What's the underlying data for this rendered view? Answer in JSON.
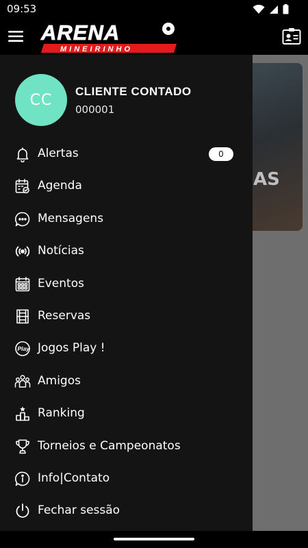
{
  "status_bar": {
    "time": "09:53"
  },
  "header": {
    "logo_main": "ARENA",
    "logo_sub": "MINEIRINHO"
  },
  "banner": {
    "text": "AS"
  },
  "user": {
    "initials": "CC",
    "name": "CLIENTE CONTADO",
    "id": "000001"
  },
  "menu": {
    "items": [
      {
        "label": "Alertas",
        "icon": "bell-icon",
        "badge": "0"
      },
      {
        "label": "Agenda",
        "icon": "calendar-check-icon"
      },
      {
        "label": "Mensagens",
        "icon": "chat-bubble-icon"
      },
      {
        "label": "Notícias",
        "icon": "broadcast-icon"
      },
      {
        "label": "Eventos",
        "icon": "calendar-grid-icon"
      },
      {
        "label": "Reservas",
        "icon": "court-icon"
      },
      {
        "label": "Jogos Play !",
        "icon": "play-badge-icon"
      },
      {
        "label": "Amigos",
        "icon": "people-icon"
      },
      {
        "label": "Ranking",
        "icon": "podium-icon"
      },
      {
        "label": "Torneios e Campeonatos",
        "icon": "trophy-icon"
      },
      {
        "label": "Info|Contato",
        "icon": "info-icon"
      },
      {
        "label": "Fechar sessão",
        "icon": "power-icon"
      }
    ]
  },
  "colors": {
    "avatar": "#6fe3c4",
    "logo_red": "#e31b1b",
    "drawer_bg": "#141414"
  }
}
